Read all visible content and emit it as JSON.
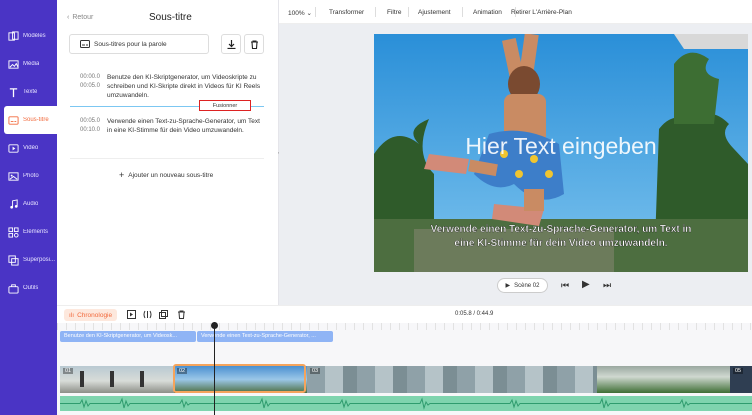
{
  "sidebar": {
    "items": [
      {
        "label": "Modèles",
        "icon": "templates-icon"
      },
      {
        "label": "Média",
        "icon": "media-icon"
      },
      {
        "label": "Texte",
        "icon": "text-icon"
      },
      {
        "label": "Sous-titre",
        "icon": "subtitle-icon",
        "active": true
      },
      {
        "label": "Vidéo",
        "icon": "video-icon"
      },
      {
        "label": "Photo",
        "icon": "photo-icon"
      },
      {
        "label": "Audio",
        "icon": "audio-icon"
      },
      {
        "label": "Éléments",
        "icon": "elements-icon"
      },
      {
        "label": "Superposi...",
        "icon": "overlay-icon"
      },
      {
        "label": "Outils",
        "icon": "tools-icon"
      }
    ]
  },
  "panel": {
    "back_label": "Retour",
    "title": "Sous-titre",
    "speech_button": "Sous-titres pour la parole",
    "merge_label": "Fusionner",
    "add_label": "Ajouter un nouveau sous-titre",
    "subtitles": [
      {
        "start": "00:00.0",
        "end": "00:05.0",
        "text": "Benutze den KI-Skriptgenerator, um Videoskripte zu schreiben und KI-Skripte direkt in Videos für KI Reels umzuwandeln."
      },
      {
        "start": "00:05.0",
        "end": "00:10.0",
        "text": "Verwende einen Text-zu-Sprache-Generator, um Text in eine KI-Stimme für dein Video umzuwandeln."
      }
    ]
  },
  "toolbar": {
    "zoom": "100%",
    "items": [
      "Transformer",
      "Filtre",
      "Ajustement",
      "Animation",
      "Retirer L'Arrière-Plan"
    ]
  },
  "preview": {
    "headline": "Hier Text eingeben",
    "caption_line1": "Verwende einen Text-zu-Sprache-Generator, um Text in",
    "caption_line2": "eine KI-Stimme für dein Video umzuwandeln."
  },
  "scene": {
    "label": "Scène 02"
  },
  "timeline": {
    "chrono_label": "Chronologie",
    "time": "0:05.8 / 0:44.9",
    "sub_clips": [
      "Benutze den KI-Skriptgenerator, um Videosk...",
      "Verwende einen Text-zu-Sprache-Generator, ..."
    ],
    "segments": [
      "01",
      "02",
      "03",
      "04",
      "05"
    ]
  },
  "colors": {
    "accent": "#f26a3d",
    "rail": "#4a34c5"
  }
}
